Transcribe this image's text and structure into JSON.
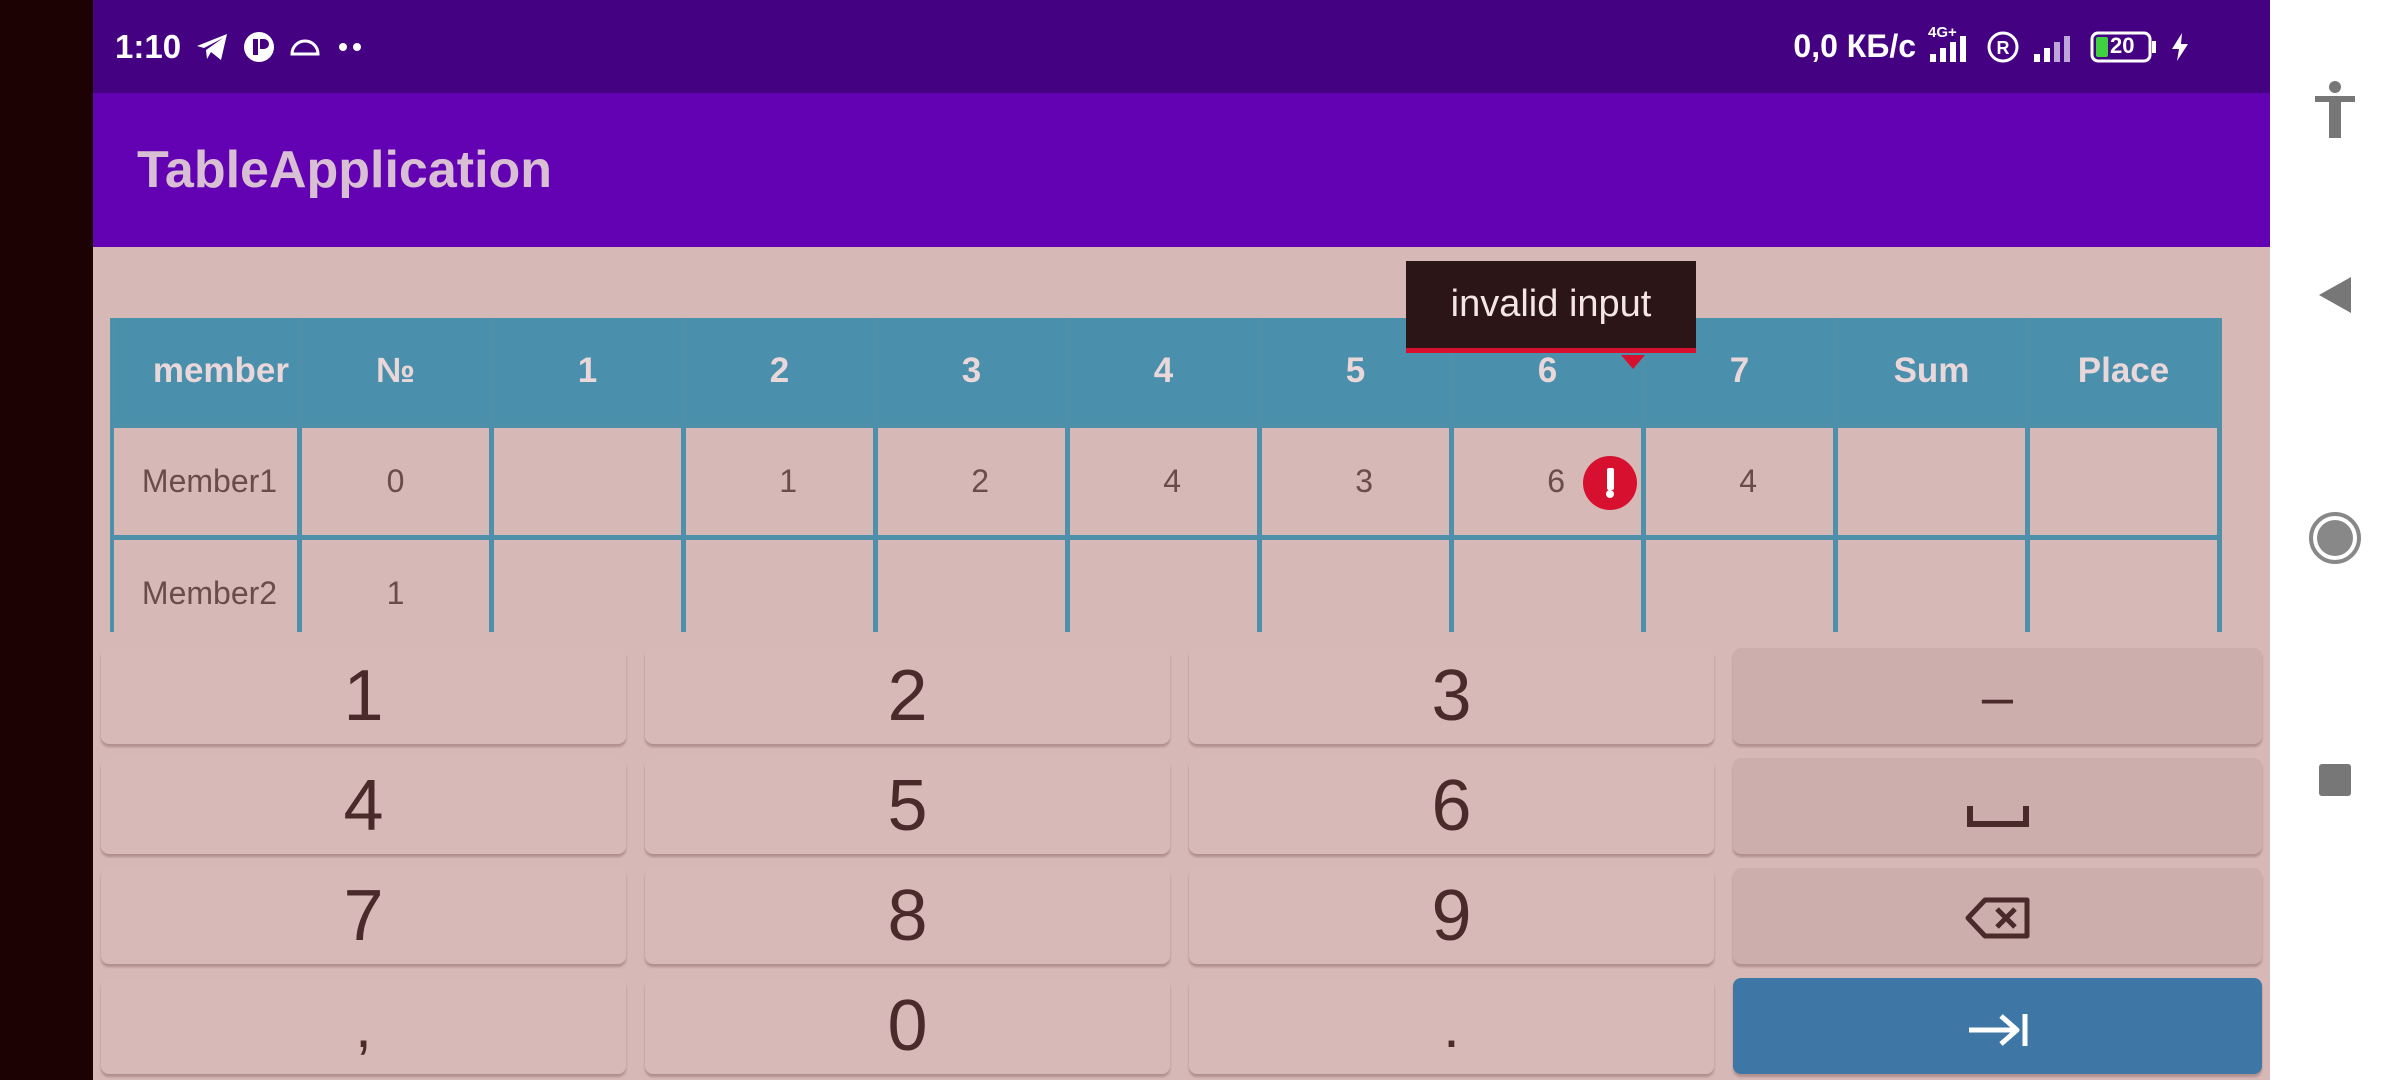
{
  "status_bar": {
    "time": "1:10",
    "network_speed": "0,0 КБ/с",
    "network_type": "4G+",
    "battery_level": "20",
    "icons": [
      "telegram-icon",
      "app-notification-icon",
      "cloud-icon",
      "more-dots-icon",
      "signal-icon",
      "roaming-icon",
      "battery-icon",
      "charging-icon"
    ]
  },
  "app_bar": {
    "title": "TableApplication"
  },
  "table": {
    "headers": [
      "member",
      "№",
      "1",
      "2",
      "3",
      "4",
      "5",
      "6",
      "7",
      "Sum",
      "Place"
    ],
    "rows": [
      [
        "Member1",
        "0",
        "",
        "1",
        "2",
        "4",
        "3",
        "6",
        "4",
        "",
        ""
      ],
      [
        "Member2",
        "1",
        "",
        "",
        "",
        "",
        "",
        "",
        "",
        "",
        ""
      ]
    ]
  },
  "tooltip": {
    "text": "invalid input"
  },
  "keypad": {
    "keys": [
      "1",
      "2",
      "3",
      "–",
      "4",
      "5",
      "6",
      "␣",
      "7",
      "8",
      "9",
      "⌫",
      ",",
      "0",
      ".",
      "⇥"
    ]
  },
  "colors": {
    "status_bar": "#440282",
    "app_bar": "#6302b2",
    "table_header": "#4a8fab",
    "background": "#d6b8b6",
    "error": "#d8102f",
    "action_key": "#3e77a6"
  }
}
